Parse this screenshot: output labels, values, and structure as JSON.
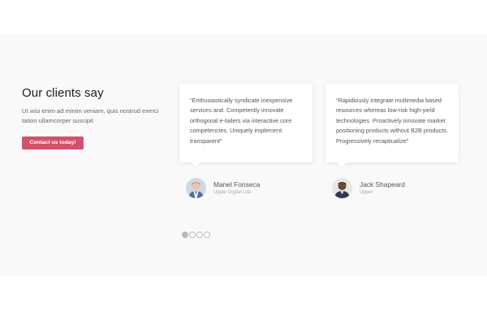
{
  "section": {
    "title": "Our clients say",
    "description": "Ut wisi enim ad minim veniam, quis nostrud exerci tation ullamcorper suscipit",
    "cta_label": "Contact us today!"
  },
  "testimonials": [
    {
      "quote": "\"Enthusiastically syndicate inexpensive services and. Competently innovate orthogonal e-tailers via interactive core competencies. Uniquely implement transparent\"",
      "name": "Manel Fonseca",
      "company": "Upper Digital Lda"
    },
    {
      "quote": "\"Rapidiously integrate multimedia based resources whereas low-risk high-yield technologies. Proactively innovate market positioning products without B2B products. Progressively recaptiualize\"",
      "name": "Jack Shapeard",
      "company": "Upper"
    }
  ],
  "pagination": {
    "total": 4,
    "active_index": 0
  },
  "colors": {
    "accent": "#d2516d",
    "band_background": "#f9f9f9"
  }
}
